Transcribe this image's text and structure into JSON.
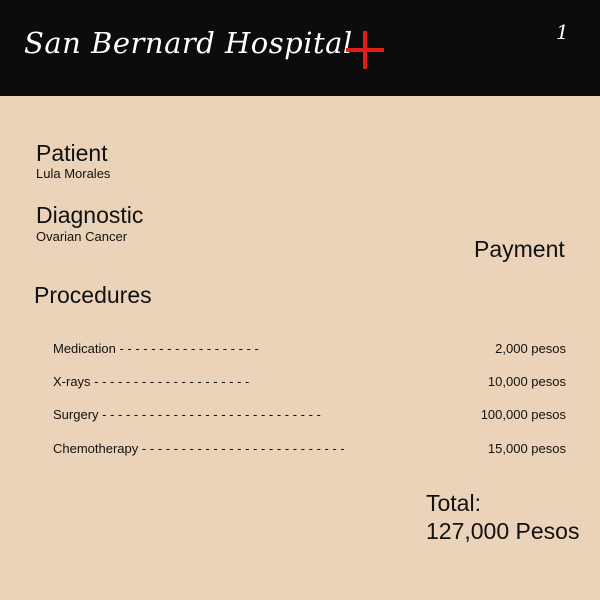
{
  "header": {
    "hospital_name": "San Bernard Hospital",
    "page_number": "1",
    "cross_color": "#e21b1b",
    "background_color": "#0d0c0c",
    "cross_icon": "red-cross-icon"
  },
  "patient": {
    "label": "Patient",
    "name": "Lula Morales"
  },
  "diagnostic": {
    "label": "Diagnostic",
    "value": "Ovarian Cancer"
  },
  "payment_heading": "Payment",
  "procedures": {
    "heading": "Procedures",
    "items": [
      {
        "name": "Medication - - - - - - - - - - - - - - - - - -",
        "price": "2,000 pesos"
      },
      {
        "name": "X-rays - - - - - - - - - - - - - - - - - - - -",
        "price": "10,000 pesos"
      },
      {
        "name": "Surgery - - - - - - - - - - - - - - - - - - - - - - - - - - -   -",
        "price": "100,000 pesos"
      },
      {
        "name": "Chemotherapy - - - - - - - - - - - - - - - - - - - - - - - - - -",
        "price": "15,000 pesos"
      }
    ]
  },
  "total": {
    "label": "Total:",
    "amount": "127,000 Pesos"
  },
  "colors": {
    "page_background": "#ebd3b9",
    "text": "#111111"
  }
}
